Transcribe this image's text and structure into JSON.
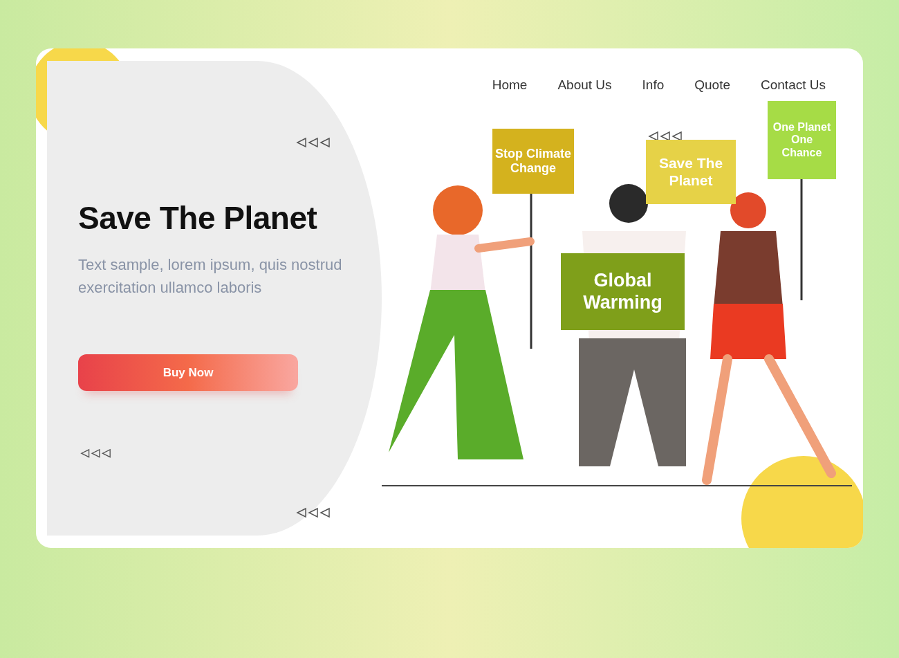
{
  "nav": [
    {
      "label": "Home"
    },
    {
      "label": "About Us"
    },
    {
      "label": "Info"
    },
    {
      "label": "Quote"
    },
    {
      "label": "Contact Us"
    }
  ],
  "hero": {
    "title": "Save The Planet",
    "text": "Text sample, lorem ipsum, quis nostrud exercitation ullamco laboris",
    "button": "Buy Now"
  },
  "signs": [
    {
      "text": "Stop Climate Change",
      "color": "#d4b21e"
    },
    {
      "text": "Global Warming",
      "color": "#7f9f1a"
    },
    {
      "text": "Save The Planet",
      "color": "#e6d247"
    },
    {
      "text": "One Planet One Chance",
      "color": "#a6dc46"
    }
  ]
}
